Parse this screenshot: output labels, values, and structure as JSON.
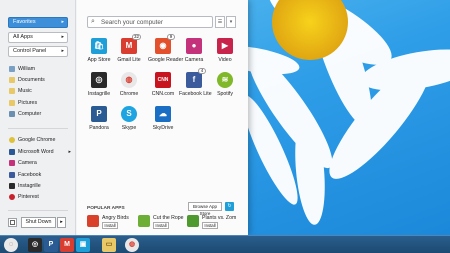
{
  "start_menu": {
    "dropdowns": {
      "favorites": "Favorites",
      "all_apps": "All Apps",
      "control_panel": "Control Panel"
    },
    "user_folders": [
      {
        "label": "William",
        "icon": "user-icon"
      },
      {
        "label": "Documents",
        "icon": "documents-icon"
      },
      {
        "label": "Music",
        "icon": "music-icon"
      },
      {
        "label": "Pictures",
        "icon": "pictures-icon"
      },
      {
        "label": "Computer",
        "icon": "computer-icon"
      }
    ],
    "recent_apps": [
      {
        "label": "Google Chrome",
        "icon": "chrome-icon"
      },
      {
        "label": "Microsoft Word",
        "icon": "word-icon"
      },
      {
        "label": "Camera",
        "icon": "camera-icon"
      },
      {
        "label": "Facebook",
        "icon": "facebook-icon"
      },
      {
        "label": "Instagrille",
        "icon": "instagrille-icon"
      },
      {
        "label": "Pinterest",
        "icon": "pinterest-icon"
      }
    ],
    "shutdown_label": "Shut Down",
    "search_placeholder": "Search your computer",
    "apps": [
      {
        "label": "App Store",
        "icon": "app-store-icon",
        "color": "#1e9fd8",
        "glyph": "🛍",
        "badge": ""
      },
      {
        "label": "Gmail Lite",
        "icon": "gmail-icon",
        "color": "#d93d30",
        "glyph": "M",
        "badge": "32"
      },
      {
        "label": "Google Reader",
        "icon": "google-reader-icon",
        "color": "#e2502c",
        "glyph": "◉",
        "badge": "9"
      },
      {
        "label": "Camera",
        "icon": "camera-icon",
        "color": "#c5327c",
        "glyph": "●",
        "badge": ""
      },
      {
        "label": "Video",
        "icon": "video-icon",
        "color": "#c8234a",
        "glyph": "▶",
        "badge": ""
      },
      {
        "label": "Instagrille",
        "icon": "instagrille-icon",
        "color": "#2a2a2a",
        "glyph": "◎",
        "badge": ""
      },
      {
        "label": "Chrome",
        "icon": "chrome-icon",
        "color": "#e8e8e8",
        "glyph": "◍",
        "badge": ""
      },
      {
        "label": "CNN.com",
        "icon": "cnn-icon",
        "color": "#c8141e",
        "glyph": "CNN",
        "badge": ""
      },
      {
        "label": "Facebook Lite",
        "icon": "facebook-icon",
        "color": "#3b5b9c",
        "glyph": "f",
        "badge": "4"
      },
      {
        "label": "Spotify",
        "icon": "spotify-icon",
        "color": "#80b82a",
        "glyph": "≋",
        "badge": ""
      },
      {
        "label": "Pandora",
        "icon": "pandora-icon",
        "color": "#2b5b93",
        "glyph": "P",
        "badge": ""
      },
      {
        "label": "Skype",
        "icon": "skype-icon",
        "color": "#1ea4e0",
        "glyph": "S",
        "badge": ""
      },
      {
        "label": "SkyDrive",
        "icon": "skydrive-icon",
        "color": "#1a6fc4",
        "glyph": "☁",
        "badge": ""
      }
    ],
    "popular": {
      "title": "POPULAR APPS",
      "browse_label": "Browse App Store",
      "install_label": "Install",
      "items": [
        {
          "label": "Angry Birds",
          "color": "#d9412b"
        },
        {
          "label": "Cut the Rope",
          "color": "#6cae36"
        },
        {
          "label": "Plants vs. Zom",
          "color": "#4f9a2e"
        }
      ]
    }
  },
  "taskbar": {
    "items": [
      {
        "icon": "start-button-icon",
        "color": "#e6e6e6",
        "glyph": "◌"
      },
      {
        "icon": "instagrille-icon",
        "color": "#2a2a2a",
        "glyph": "◎"
      },
      {
        "icon": "pandora-icon",
        "color": "#2b5b93",
        "glyph": "P"
      },
      {
        "icon": "gmail-icon",
        "color": "#d93d30",
        "glyph": "M"
      },
      {
        "icon": "app-store-icon",
        "color": "#1e9fd8",
        "glyph": "▣"
      },
      {
        "icon": "file-explorer-icon",
        "color": "#e9c867",
        "glyph": "▭"
      },
      {
        "icon": "chrome-icon",
        "color": "#e8e8e8",
        "glyph": "◍"
      }
    ]
  }
}
